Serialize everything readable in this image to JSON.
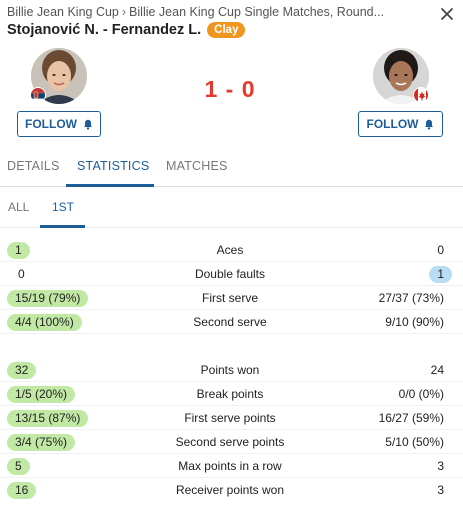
{
  "breadcrumb": {
    "item1": "Billie Jean King Cup",
    "separator": "›",
    "item2": "Billie Jean King Cup Single Matches, Round..."
  },
  "match": {
    "title": "Stojanović N. - Fernandez L.",
    "surface": "Clay",
    "score": "1 - 0"
  },
  "players": {
    "p1": {
      "follow_label": "FOLLOW",
      "flag": "Serbia"
    },
    "p2": {
      "follow_label": "FOLLOW",
      "flag": "Canada"
    }
  },
  "tabs": [
    {
      "label": "DETAILS",
      "active": false
    },
    {
      "label": "STATISTICS",
      "active": true
    },
    {
      "label": "MATCHES",
      "active": false
    }
  ],
  "subtabs": [
    {
      "label": "ALL",
      "active": false
    },
    {
      "label": "1ST",
      "active": true
    }
  ],
  "stats_group1": [
    {
      "label": "Aces",
      "left": "1",
      "right": "0",
      "winner": "left"
    },
    {
      "label": "Double faults",
      "left": "0",
      "right": "1",
      "winner": "right"
    },
    {
      "label": "First serve",
      "left": "15/19 (79%)",
      "right": "27/37 (73%)",
      "winner": "left"
    },
    {
      "label": "Second serve",
      "left": "4/4 (100%)",
      "right": "9/10 (90%)",
      "winner": "left"
    }
  ],
  "stats_group2": [
    {
      "label": "Points won",
      "left": "32",
      "right": "24",
      "winner": "left"
    },
    {
      "label": "Break points",
      "left": "1/5 (20%)",
      "right": "0/0 (0%)",
      "winner": "left"
    },
    {
      "label": "First serve points",
      "left": "13/15 (87%)",
      "right": "16/27 (59%)",
      "winner": "left"
    },
    {
      "label": "Second serve points",
      "left": "3/4 (75%)",
      "right": "5/10 (50%)",
      "winner": "left"
    },
    {
      "label": "Max points in a row",
      "left": "5",
      "right": "3",
      "winner": "left"
    },
    {
      "label": "Receiver points won",
      "left": "16",
      "right": "3",
      "winner": "left"
    }
  ],
  "colors": {
    "accent": "#1d5e9a",
    "score": "#e33a2f",
    "surface_badge": "#f0961e",
    "win_left": "#c2e8a5",
    "win_right": "#b9dcf5"
  }
}
